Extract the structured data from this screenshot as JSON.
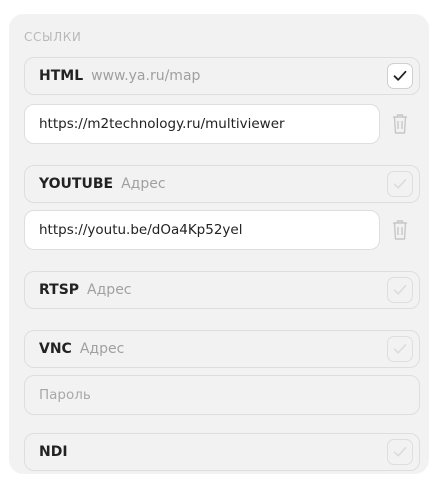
{
  "section": {
    "title": "ссылки"
  },
  "links": {
    "html": {
      "name": "HTML",
      "address": "www.ya.ru/map",
      "checked": true,
      "url": "https://m2technology.ru/multiviewer"
    },
    "youtube": {
      "name": "YOUTUBE",
      "address_placeholder": "Адрес",
      "checked": false,
      "url": "https://youtu.be/dOa4Kp52yel"
    },
    "rtsp": {
      "name": "RTSP",
      "address_placeholder": "Адрес",
      "checked": false
    },
    "vnc": {
      "name": "VNC",
      "address_placeholder": "Адрес",
      "checked": false,
      "password_placeholder": "Пароль"
    },
    "ndi": {
      "name": "NDI",
      "checked": false
    }
  },
  "icons": {
    "check": "check-icon",
    "delete": "trash-icon"
  },
  "colors": {
    "panel": "#f2f2f2",
    "border": "#dedede",
    "muted": "#a0a0a0",
    "text": "#222222"
  }
}
